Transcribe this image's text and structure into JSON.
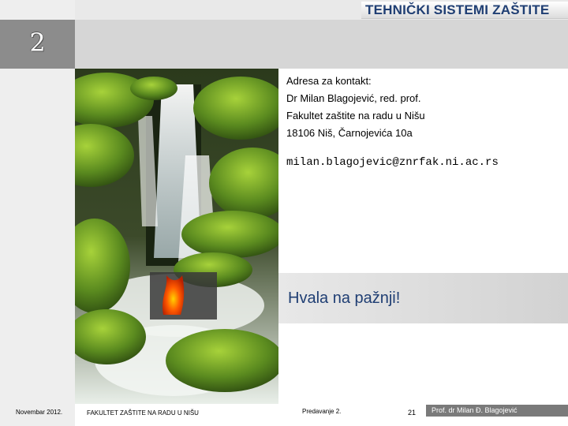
{
  "slide": {
    "brand_title": "TEHNIČKI SISTEMI ZAŠTITE",
    "chapter_number": "2"
  },
  "contact": {
    "lines": [
      "Adresa za kontakt:",
      "Dr Milan Blagojević, red. prof.",
      "Fakultet zaštite na radu u Nišu",
      "18106 Niš, Čarnojevića 10a"
    ],
    "email": "milan.blagojevic@znrfak.ni.ac.rs"
  },
  "thanks": "Hvala na pažnji!",
  "footer": {
    "date": "Novembar 2012.",
    "faculty": "FAKULTET ZAŠTITE NA RADU U NIŠU",
    "lecture": "Predavanje 2.",
    "page": "21",
    "author": "Prof. dr Milan Đ. Blagojević"
  },
  "colors": {
    "title_blue": "#1f3e73",
    "moss_green": "#5a8a1f",
    "lava_orange": "#ff5a00"
  }
}
